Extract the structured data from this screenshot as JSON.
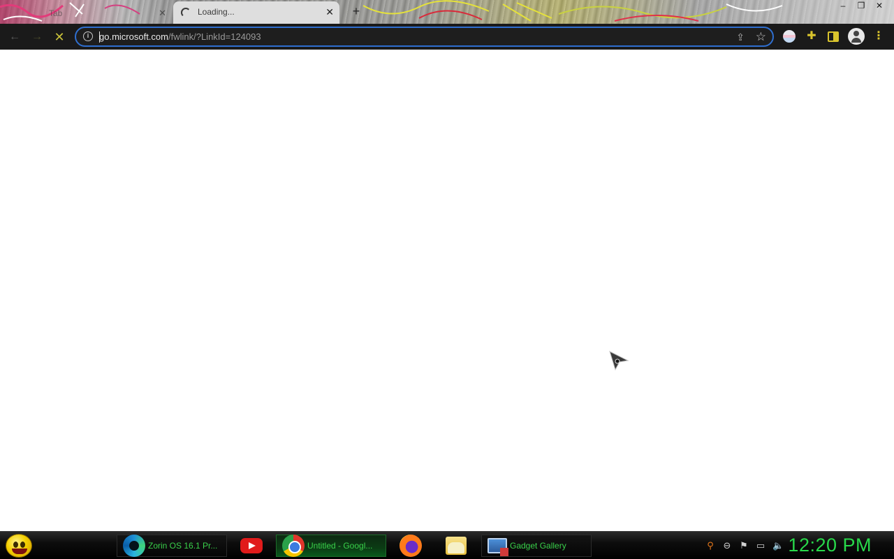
{
  "browser": {
    "tabs": [
      {
        "title": "Tab",
        "state": "inactive"
      },
      {
        "title": "Loading...",
        "state": "active-loading"
      }
    ],
    "new_tab_symbol": "+",
    "window_controls": {
      "minimize": "–",
      "maximize": "❐",
      "close": "✕"
    },
    "toolbar": {
      "back_icon": "←",
      "forward_icon": "→",
      "stop_icon": "✕"
    },
    "address_bar": {
      "domain": "go.microsoft.com",
      "path": "/fwlink/?LinkId=124093"
    },
    "colors": {
      "toolbar_bg": "#1a1a1a",
      "omnibox_focus_border": "#2f6fd0",
      "accent_yellow": "#d9c42d"
    }
  },
  "taskbar": {
    "tasks": [
      {
        "label": "Zorin OS 16.1 Pr...",
        "icon": "edge-icon"
      },
      {
        "label": "",
        "icon": "youtube-icon"
      },
      {
        "label": "Untitled - Googl...",
        "icon": "chrome-icon"
      },
      {
        "label": "",
        "icon": "firefox-icon"
      },
      {
        "label": "",
        "icon": "folder-icon"
      },
      {
        "label": "Gadget Gallery",
        "icon": "gadget-icon"
      }
    ],
    "clock": "12:20 PM",
    "clock_color": "#28d84a"
  }
}
